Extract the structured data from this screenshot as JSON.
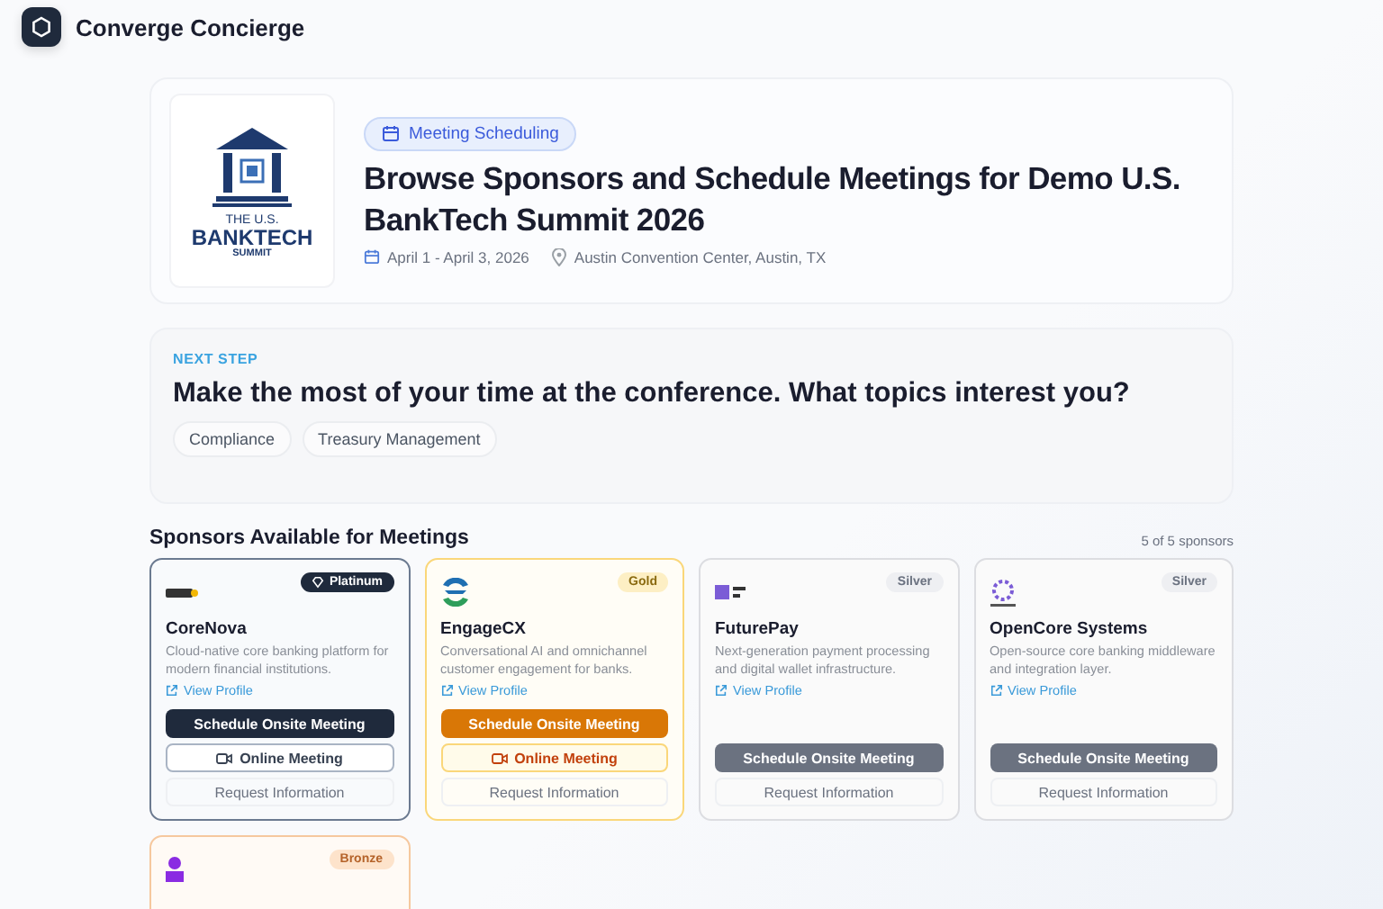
{
  "app": {
    "name": "Converge Concierge"
  },
  "event": {
    "logo_lines": [
      "THE U.S.",
      "BANKTECH",
      "SUMMIT"
    ],
    "tag": "Meeting Scheduling",
    "title": "Browse Sponsors and Schedule Meetings for Demo U.S. BankTech Summit 2026",
    "dates": "April 1 - April 3, 2026",
    "venue": "Austin Convention Center, Austin, TX"
  },
  "next_step": {
    "eyebrow": "NEXT STEP",
    "question": "Make the most of your time at the conference. What topics interest you?",
    "topics": [
      "Compliance",
      "Treasury Management"
    ]
  },
  "sponsors": {
    "heading": "Sponsors Available for Meetings",
    "count": "5 of 5 sponsors",
    "items": [
      {
        "kind": "platinum",
        "badge": "Platinum",
        "name": "CoreNova",
        "description": "Cloud-native core banking platform for modern financial institutions.",
        "link": "View Profile",
        "buttons": [
          {
            "kind": "onsite",
            "label": "Schedule Onsite Meeting"
          },
          {
            "kind": "online",
            "label": "Online Meeting"
          },
          {
            "kind": "request",
            "label": "Request Information"
          }
        ]
      },
      {
        "kind": "gold",
        "badge": "Gold",
        "name": "EngageCX",
        "description": "Conversational AI and omnichannel customer engagement for banks.",
        "link": "View Profile",
        "buttons": [
          {
            "kind": "onsite",
            "label": "Schedule Onsite Meeting"
          },
          {
            "kind": "online",
            "label": "Online Meeting"
          },
          {
            "kind": "request",
            "label": "Request Information"
          }
        ]
      },
      {
        "kind": "silver",
        "badge": "Silver",
        "name": "FuturePay",
        "description": "Next-generation payment processing and digital wallet infrastructure.",
        "link": "View Profile",
        "buttons": [
          {
            "kind": "onsite",
            "label": "Schedule Onsite Meeting"
          },
          {
            "kind": "request",
            "label": "Request Information"
          }
        ]
      },
      {
        "kind": "silver",
        "badge": "Silver",
        "name": "OpenCore Systems",
        "description": "Open-source core banking middleware and integration layer.",
        "link": "View Profile",
        "buttons": [
          {
            "kind": "onsite",
            "label": "Schedule Onsite Meeting"
          },
          {
            "kind": "request",
            "label": "Request Information"
          }
        ]
      },
      {
        "kind": "bronze",
        "badge": "Bronze"
      }
    ]
  }
}
